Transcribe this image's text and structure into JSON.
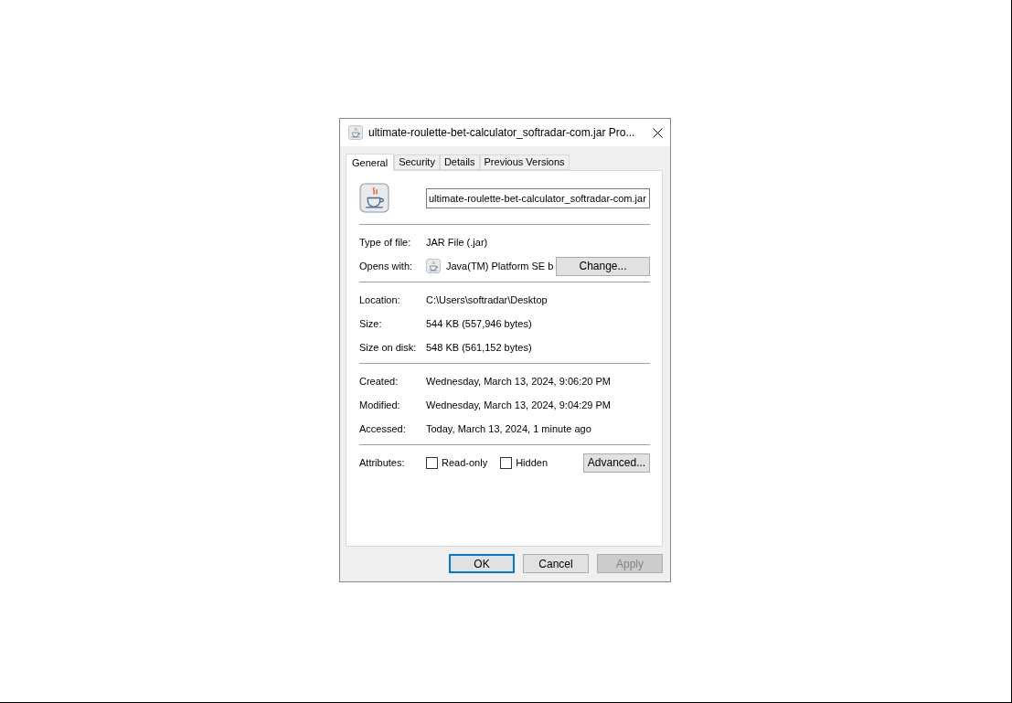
{
  "window": {
    "title": "ultimate-roulette-bet-calculator_softradar-com.jar Pro..."
  },
  "tabs": [
    {
      "label": "General",
      "selected": true
    },
    {
      "label": "Security",
      "selected": false
    },
    {
      "label": "Details",
      "selected": false
    },
    {
      "label": "Previous Versions",
      "selected": false
    }
  ],
  "file_name": "ultimate-roulette-bet-calculator_softradar-com.jar",
  "sections": [
    [
      {
        "label": "Type of file:",
        "value": "JAR File (.jar)"
      },
      {
        "label": "Opens with:",
        "value": "Java(TM) Platform SE b",
        "button": "Change..."
      }
    ],
    [
      {
        "label": "Location:",
        "value": "C:\\Users\\softradar\\Desktop"
      },
      {
        "label": "Size:",
        "value": "544 KB (557,946 bytes)"
      },
      {
        "label": "Size on disk:",
        "value": "548 KB (561,152 bytes)"
      }
    ],
    [
      {
        "label": "Created:",
        "value": "Wednesday, March 13, 2024, 9:06:20 PM"
      },
      {
        "label": "Modified:",
        "value": "Wednesday, March 13, 2024, 9:04:29 PM"
      },
      {
        "label": "Accessed:",
        "value": "Today, March 13, 2024, 1 minute ago"
      }
    ]
  ],
  "attributes": {
    "label": "Attributes:",
    "checkboxes": [
      {
        "label": "Read-only",
        "checked": false
      },
      {
        "label": "Hidden",
        "checked": false
      }
    ],
    "button": "Advanced..."
  },
  "buttons": [
    {
      "label": "OK",
      "default": true,
      "disabled": false
    },
    {
      "label": "Cancel",
      "default": false,
      "disabled": false
    },
    {
      "label": "Apply",
      "default": false,
      "disabled": true
    }
  ]
}
